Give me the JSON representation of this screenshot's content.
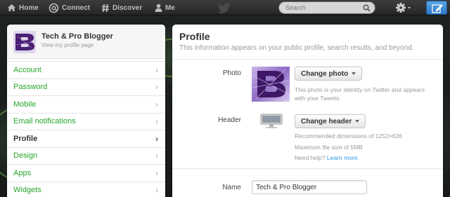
{
  "nav": {
    "home": "Home",
    "connect": "Connect",
    "discover": "Discover",
    "me": "Me",
    "search_placeholder": "Search"
  },
  "account_card": {
    "name": "Tech & Pro Blogger",
    "link": "View my profile page"
  },
  "menu": [
    {
      "label": "Account",
      "active": false
    },
    {
      "label": "Password",
      "active": false
    },
    {
      "label": "Mobile",
      "active": false
    },
    {
      "label": "Email notifications",
      "active": false
    },
    {
      "label": "Profile",
      "active": true
    },
    {
      "label": "Design",
      "active": false
    },
    {
      "label": "Apps",
      "active": false
    },
    {
      "label": "Widgets",
      "active": false
    }
  ],
  "profile": {
    "title": "Profile",
    "subtitle": "This information appears on your public profile, search results, and beyond.",
    "photo_label": "Photo",
    "change_photo": "Change photo",
    "photo_help_1": "This photo is your identity on Twitter and appears",
    "photo_help_2": "with your Tweets.",
    "header_label": "Header",
    "change_header": "Change header",
    "header_help_1": "Recommended dimensions of 1252×626",
    "header_help_2": "Maximum file size of 5MB",
    "need_help": "Need help?",
    "learn_more": "Learn more.",
    "name_label": "Name",
    "name_value": "Tech & Pro Blogger"
  },
  "colors": {
    "link_green": "#26a52a",
    "link_blue": "#2b9be0",
    "logo_purple": "#5a2a82"
  }
}
